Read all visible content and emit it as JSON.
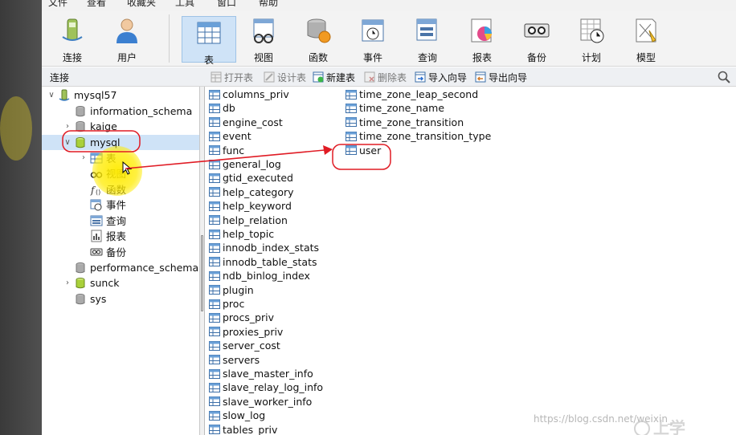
{
  "menu": [
    "文件",
    "查看",
    "收藏夹",
    "工具",
    "窗口",
    "帮助"
  ],
  "toolbar": {
    "buttons": [
      {
        "label": "连接",
        "icon": "connection-icon"
      },
      {
        "label": "用户",
        "icon": "user-icon"
      },
      {
        "label": "表",
        "icon": "table-icon",
        "active": true
      },
      {
        "label": "视图",
        "icon": "view-icon"
      },
      {
        "label": "函数",
        "icon": "function-icon"
      },
      {
        "label": "事件",
        "icon": "event-icon"
      },
      {
        "label": "查询",
        "icon": "query-icon"
      },
      {
        "label": "报表",
        "icon": "report-icon"
      },
      {
        "label": "备份",
        "icon": "backup-icon"
      },
      {
        "label": "计划",
        "icon": "schedule-icon"
      },
      {
        "label": "模型",
        "icon": "model-icon"
      }
    ]
  },
  "subbar": {
    "connection_label": "连接",
    "actions": [
      {
        "label": "打开表",
        "enabled": false
      },
      {
        "label": "设计表",
        "enabled": false
      },
      {
        "label": "新建表",
        "enabled": true
      },
      {
        "label": "删除表",
        "enabled": false
      },
      {
        "label": "导入向导",
        "enabled": true
      },
      {
        "label": "导出向导",
        "enabled": true
      }
    ]
  },
  "tree": {
    "connection": "mysql57",
    "databases": [
      {
        "name": "information_schema"
      },
      {
        "name": "kaige"
      },
      {
        "name": "mysql",
        "expanded": true,
        "selected": true
      },
      {
        "name": "performance_schema"
      },
      {
        "name": "sunck"
      },
      {
        "name": "sys"
      }
    ],
    "mysql_children": [
      {
        "label": "表",
        "icon": "table-icon"
      },
      {
        "label": "视图",
        "icon": "view-icon"
      },
      {
        "label": "函数",
        "icon": "function-icon"
      },
      {
        "label": "事件",
        "icon": "event-icon"
      },
      {
        "label": "查询",
        "icon": "query-icon"
      },
      {
        "label": "报表",
        "icon": "report-icon"
      },
      {
        "label": "备份",
        "icon": "backup-icon"
      }
    ]
  },
  "tables_col1": [
    "columns_priv",
    "db",
    "engine_cost",
    "event",
    "func",
    "general_log",
    "gtid_executed",
    "help_category",
    "help_keyword",
    "help_relation",
    "help_topic",
    "innodb_index_stats",
    "innodb_table_stats",
    "ndb_binlog_index",
    "plugin",
    "proc",
    "procs_priv",
    "proxies_priv",
    "server_cost",
    "servers",
    "slave_master_info",
    "slave_relay_log_info",
    "slave_worker_info",
    "slow_log",
    "tables_priv"
  ],
  "tables_col2": [
    "time_zone_leap_second",
    "time_zone_name",
    "time_zone_transition",
    "time_zone_transition_type",
    "user"
  ],
  "watermark": "https://blog.csdn.net/weixin_",
  "colors": {
    "selection": "#cfe3f7",
    "annotation": "#e01b24",
    "highlight": "#ffeb00"
  }
}
